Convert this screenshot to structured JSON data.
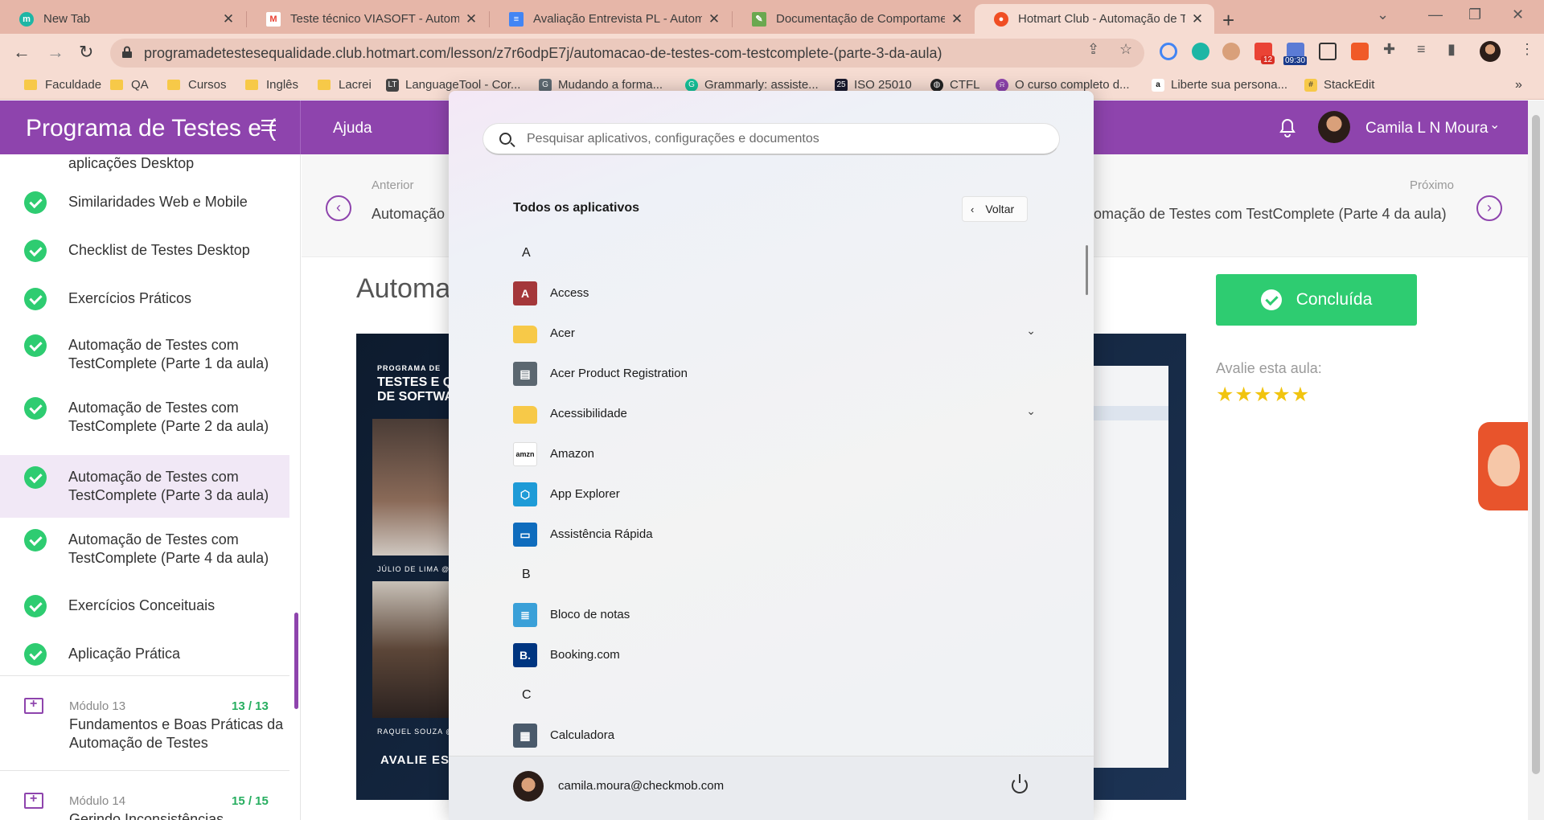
{
  "browser": {
    "tabs": [
      {
        "title": "New Tab",
        "icon": "m-icon",
        "color": "#1db6a5"
      },
      {
        "title": "Teste técnico VIASOFT - Automat",
        "icon": "gmail-icon",
        "color": "#ea4335"
      },
      {
        "title": "Avaliação Entrevista PL - Automa",
        "icon": "docs-icon",
        "color": "#4285f4"
      },
      {
        "title": "Documentação de Comportamen",
        "icon": "notepad-icon",
        "color": "#6aa84f"
      },
      {
        "title": "Hotmart Club - Automação de Te",
        "icon": "hotmart-icon",
        "color": "#f04e23"
      }
    ],
    "url": "programadetestesequalidade.club.hotmart.com/lesson/z7r6odpE7j/automacao-de-testes-com-testcomplete-(parte-3-da-aula)",
    "extension_badges": {
      "mail_count": "12",
      "clock": "09:30"
    },
    "bookmarks": [
      {
        "label": "Faculdade",
        "type": "folder"
      },
      {
        "label": "QA",
        "type": "folder"
      },
      {
        "label": "Cursos",
        "type": "folder"
      },
      {
        "label": "Inglês",
        "type": "folder"
      },
      {
        "label": "Lacrei",
        "type": "folder"
      },
      {
        "label": "LanguageTool - Cor...",
        "type": "link"
      },
      {
        "label": "Mudando a forma...",
        "type": "link"
      },
      {
        "label": "Grammarly: assiste...",
        "type": "link"
      },
      {
        "label": "ISO 25010",
        "type": "link"
      },
      {
        "label": "CTFL",
        "type": "link"
      },
      {
        "label": "O curso completo d...",
        "type": "link"
      },
      {
        "label": "Liberte sua persona...",
        "type": "link"
      },
      {
        "label": "StackEdit",
        "type": "link"
      }
    ]
  },
  "site": {
    "title": "Programa de Testes e (",
    "help": "Ajuda",
    "user_name": "Camila L N Moura",
    "accent": "#8e44ad"
  },
  "sidebar": {
    "partial_top": "aplicações Desktop",
    "lessons": [
      {
        "label": "Similaridades Web e Mobile"
      },
      {
        "label": "Checklist de Testes Desktop"
      },
      {
        "label": "Exercícios Práticos"
      },
      {
        "label": "Automação de Testes com TestComplete (Parte 1 da aula)"
      },
      {
        "label": "Automação de Testes com TestComplete (Parte 2 da aula)"
      },
      {
        "label": "Automação de Testes com TestComplete (Parte 3 da aula)",
        "active": true
      },
      {
        "label": "Automação de Testes com TestComplete (Parte 4 da aula)"
      },
      {
        "label": "Exercícios Conceituais"
      },
      {
        "label": "Aplicação Prática"
      }
    ],
    "modules": [
      {
        "number": "Módulo 13",
        "count": "13 / 13",
        "title": "Fundamentos e Boas Práticas da Automação de Testes"
      },
      {
        "number": "Módulo 14",
        "count": "15 / 15",
        "title": "Gerindo Inconsistências"
      }
    ]
  },
  "lesson": {
    "prev_label": "Anterior",
    "prev_title": "Automação",
    "next_label": "Próximo",
    "next_title": "tomação de Testes com TestComplete (Parte 4 da aula)",
    "title": "Automa",
    "done_button": "Concluída",
    "rate_label": "Avalie esta aula:",
    "rating": 5,
    "video": {
      "kicker": "PROGRAMA DE",
      "headline_1": "TESTES E QU",
      "headline_2": "DE SOFTWA",
      "caption_1": "JÚLIO DE LIMA @ IN",
      "caption_2": "RAQUEL SOUZA @",
      "cta": "AVALIE ESS"
    }
  },
  "start_menu": {
    "search_placeholder": "Pesquisar aplicativos, configurações e documentos",
    "heading": "Todos os aplicativos",
    "back_button": "Voltar",
    "sections": [
      {
        "letter": "A",
        "apps": [
          {
            "label": "Access",
            "icon": "access-icon",
            "color": "#a4373a"
          },
          {
            "label": "Acer",
            "icon": "folder-icon",
            "color": "#f7c948",
            "expandable": true
          },
          {
            "label": "Acer Product Registration",
            "icon": "acer-registration-icon",
            "color": "#5b6770"
          },
          {
            "label": "Acessibilidade",
            "icon": "folder-icon",
            "color": "#f7c948",
            "expandable": true
          },
          {
            "label": "Amazon",
            "icon": "amazon-icon",
            "color": "#ffffff"
          },
          {
            "label": "App Explorer",
            "icon": "app-explorer-icon",
            "color": "#1e9bd7"
          },
          {
            "label": "Assistência Rápida",
            "icon": "quick-assist-icon",
            "color": "#0f6cbd"
          }
        ]
      },
      {
        "letter": "B",
        "apps": [
          {
            "label": "Bloco de notas",
            "icon": "notepad-icon",
            "color": "#3aa0d8"
          },
          {
            "label": "Booking.com",
            "icon": "booking-icon",
            "color": "#003580"
          }
        ]
      },
      {
        "letter": "C",
        "apps": [
          {
            "label": "Calculadora",
            "icon": "calculator-icon",
            "color": "#4a5a6b"
          }
        ]
      }
    ],
    "user_email": "camila.moura@checkmob.com"
  }
}
